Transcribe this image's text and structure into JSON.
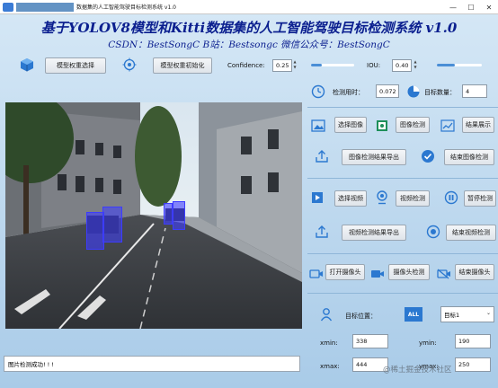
{
  "window": {
    "title": "数据集的人工智能驾驶目标检测系统 v1.0",
    "controls": [
      "—",
      "☐",
      "✕"
    ]
  },
  "header": {
    "title": "基于YOLOV8模型和Kitti数据集的人工智能驾驶目标检测系统 v1.0",
    "subtitle": "CSDN：BestSongC  B站：Bestsongc  微信公众号：BestSongC"
  },
  "toolbar": {
    "select_weights_label": "模型权重选择",
    "init_weights_label": "模型权重初始化",
    "confidence_label": "Confidence:",
    "confidence_value": "0.25",
    "confidence_level": 0.25,
    "iou_label": "IOU:",
    "iou_value": "0.40",
    "iou_level": 0.4
  },
  "stats": {
    "time_label": "检测用时：",
    "time_value": "0.072",
    "count_label": "目标数量：",
    "count_value": "4"
  },
  "image_section": {
    "select_label": "选择图像",
    "detect_label": "图像检测",
    "show_label": "结果展示",
    "export_label": "图像检测结果导出",
    "end_label": "结束图像检测"
  },
  "video_section": {
    "select_label": "选择视频",
    "detect_label": "视频检测",
    "pause_label": "暂停检测",
    "export_label": "视频检测结果导出",
    "end_label": "结束视频检测"
  },
  "camera_section": {
    "open_label": "打开摄像头",
    "detect_label": "摄像头检测",
    "close_label": "结束摄像头"
  },
  "position": {
    "label": "目标位置：",
    "select_value": "目标1",
    "xmin_label": "xmin:",
    "xmin_value": "338",
    "ymin_label": "ymin:",
    "ymin_value": "190",
    "xmax_label": "xmax:",
    "xmax_value": "444",
    "ymax_label": "ymax:",
    "ymax_value": "250"
  },
  "status": {
    "text": "图片检测成功! ! !"
  },
  "watermark": "@稀土掘金技术社区",
  "colors": {
    "title": "#0b1f8f",
    "background_top": "#d6e8f6",
    "background_bottom": "#a9cbe8",
    "detection_box": "#3d3cff",
    "icon_blue": "#2b78d0"
  }
}
